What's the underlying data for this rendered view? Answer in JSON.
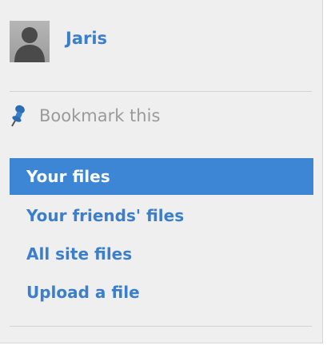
{
  "owner": {
    "name": "Jaris",
    "avatar_icon": "user-silhouette-icon"
  },
  "bookmark": {
    "icon": "pushpin-icon",
    "label": "Bookmark this"
  },
  "menu": {
    "items": [
      {
        "label": "Your files",
        "active": true
      },
      {
        "label": "Your friends' files",
        "active": false
      },
      {
        "label": "All site files",
        "active": false
      },
      {
        "label": "Upload a file",
        "active": false
      }
    ]
  },
  "colors": {
    "link": "#3b7fcc",
    "active_bg": "#3d86d6",
    "panel_bg": "#efefef",
    "muted_text": "#9a9a9a"
  }
}
